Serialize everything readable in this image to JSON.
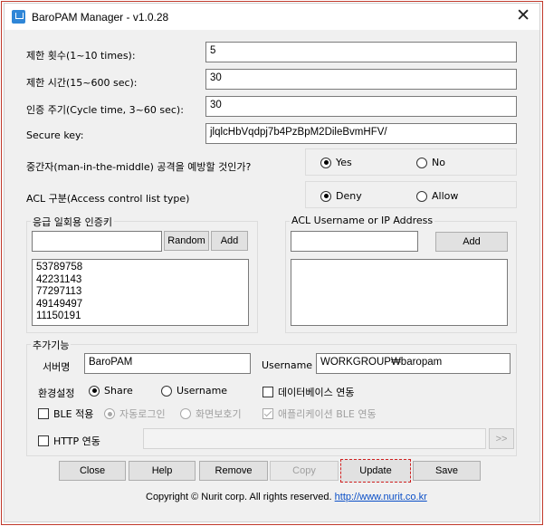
{
  "window": {
    "title": "BaroPAM Manager - v1.0.28",
    "close_glyph": "✕"
  },
  "settings": {
    "limit_count_label": "제한 횟수(1~10 times):",
    "limit_count_value": "5",
    "limit_time_label": "제한 시간(15~600 sec):",
    "limit_time_value": "30",
    "cycle_label": "인증 주기(Cycle time, 3~60 sec):",
    "cycle_value": "30",
    "secure_key_label": "Secure key:",
    "secure_key_value": "jlqlcHbVqdpj7b4PzBpM2DileBvmHFV/"
  },
  "mitm": {
    "label": "중간자(man-in-the-middle) 공격을 예방할 것인가?",
    "yes": "Yes",
    "no": "No"
  },
  "acl_type": {
    "label": "ACL 구분(Access control list type)",
    "deny": "Deny",
    "allow": "Allow"
  },
  "emergency": {
    "title": "응급 일회용 인증키",
    "random_button": "Random",
    "add_button": "Add",
    "keys": [
      "53789758",
      "42231143",
      "77297113",
      "49149497",
      "11150191"
    ]
  },
  "acl_list": {
    "title": "ACL Username or IP Address",
    "add_button": "Add"
  },
  "extra": {
    "title": "추가기능",
    "server_name_label": "서버명",
    "server_name_value": "BaroPAM",
    "username_label": "Username",
    "username_value": "WORKGROUP₩baropam",
    "env_label": "환경설정",
    "env_share": "Share",
    "env_username": "Username",
    "database_link": "데이터베이스 연동",
    "ble_apply": "BLE 적용",
    "auto_login": "자동로그인",
    "screen_protect": "화면보호기",
    "app_ble_link": "애플리케이션 BLE 연동",
    "http_link": "HTTP 연동",
    "http_go": ">>"
  },
  "buttons": {
    "close": "Close",
    "help": "Help",
    "remove": "Remove",
    "copy": "Copy",
    "update": "Update",
    "save": "Save"
  },
  "footer": {
    "copyright": "Copyright © Nurit corp. All rights reserved.",
    "url": "http://www.nurit.co.kr"
  },
  "colors": {
    "highlight_border": "#d02020",
    "link": "#0b4fc7"
  }
}
